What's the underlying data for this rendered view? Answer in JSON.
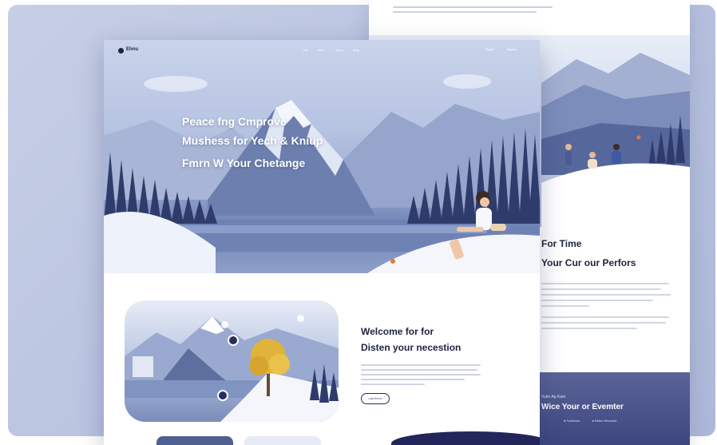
{
  "front": {
    "logo": "Ehnu",
    "nav_links": [
      "Hm",
      "Abnt",
      "Servc",
      "Blog"
    ],
    "nav_actions": [
      "Signin",
      "Signup"
    ],
    "hero_lines": [
      "Peace fng Cmprove",
      "Mushess for Yech & Kniup",
      "Fmrn W Your Chetange"
    ],
    "welcome_line1": "Welcome for for",
    "welcome_line2": "Disten your necestion",
    "learn_button": "Lea fm rn"
  },
  "back": {
    "section_title1": "For Time",
    "section_title2": "Your Cur our Perfors",
    "footer_small": "Vulm Ag Kam",
    "footer_title": "Wice Your or Evemter",
    "footer_links": [
      "Fuuthmm",
      "Bidnu Wnuuhur"
    ]
  },
  "colors": {
    "accent": "#23265a",
    "backdrop": "#b8c2df",
    "heading": "#1f2340"
  }
}
